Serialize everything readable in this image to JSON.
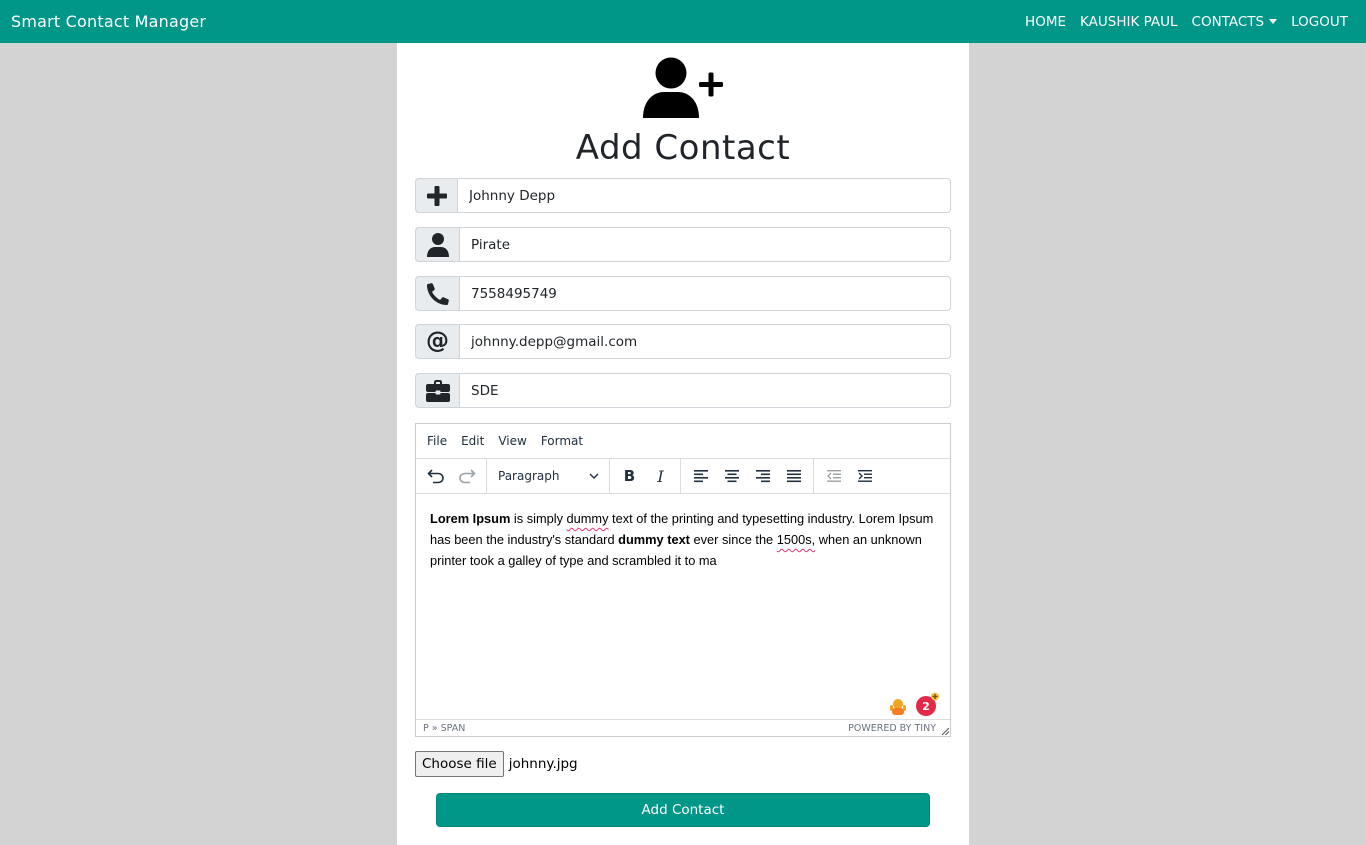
{
  "navbar": {
    "brand": "Smart Contact Manager",
    "links": {
      "home": "HOME",
      "user": "KAUSHIK PAUL",
      "contacts": "CONTACTS",
      "logout": "LOGOUT"
    },
    "color": "#009688"
  },
  "form": {
    "title": "Add Contact",
    "fields": {
      "name": "Johnny Depp",
      "nickname": "Pirate",
      "phone": "7558495749",
      "email": "johnny.depp@gmail.com",
      "work": "SDE"
    },
    "icons": {
      "title": "user-plus-icon",
      "name": "plus-icon",
      "nickname": "user-icon",
      "phone": "phone-icon",
      "email": "at-icon",
      "work": "briefcase-icon"
    }
  },
  "editor": {
    "menu": {
      "file": "File",
      "edit": "Edit",
      "view": "View",
      "format": "Format"
    },
    "block_format": "Paragraph",
    "content": {
      "b1": "Lorem Ipsum",
      "t1": " is simply ",
      "s1": "dummy",
      "t2": " text of the printing and typesetting industry. Lorem Ipsum has been the industry's standard ",
      "b2": "dummy text",
      "t3": " ever since the ",
      "s2": "1500s,",
      "t4": " when an unknown printer took a galley of type and scrambled it to ma"
    },
    "path": "P » SPAN",
    "powered": "POWERED BY TINY",
    "grammarly_count": "2"
  },
  "file": {
    "button": "Choose file",
    "name": "johnny.jpg"
  },
  "submit": "Add Contact"
}
